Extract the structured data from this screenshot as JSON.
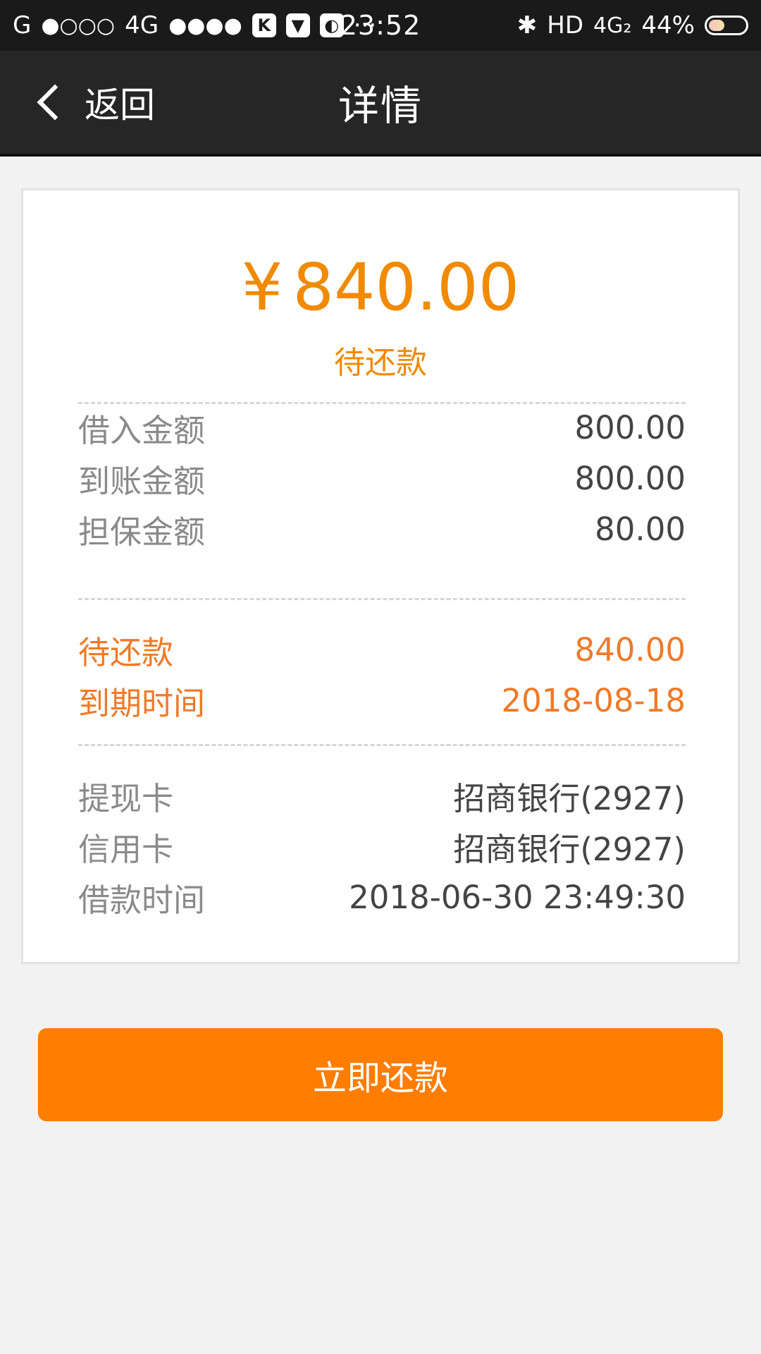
{
  "status_bar": {
    "carrier_1": "G",
    "signal_1": "●○○○",
    "network_2": "4G",
    "signal_2": "●●●●",
    "app_icon_k": "K",
    "more": "···",
    "time": "23:52",
    "bluetooth": "✱",
    "hd": "HD",
    "network_3": "4G₂",
    "battery_percent": "44%",
    "battery_level": 0.44
  },
  "nav": {
    "back_label": "返回",
    "title": "详情"
  },
  "summary": {
    "currency": "¥",
    "amount": "840.00",
    "status": "待还款"
  },
  "loan_rows": [
    {
      "label": "借入金额",
      "value": "800.00"
    },
    {
      "label": "到账金额",
      "value": "800.00"
    },
    {
      "label": "担保金额",
      "value": "80.00"
    }
  ],
  "due_rows": [
    {
      "label": "待还款",
      "value": "840.00"
    },
    {
      "label": "到期时间",
      "value": "2018-08-18"
    }
  ],
  "card_rows": [
    {
      "label": "提现卡",
      "value": "招商银行(2927)"
    },
    {
      "label": "信用卡",
      "value": "招商银行(2927)"
    },
    {
      "label": "借款时间",
      "value": "2018-06-30 23:49:30"
    }
  ],
  "actions": {
    "repay_label": "立即还款"
  },
  "colors": {
    "accent": "#ff7d00",
    "amount": "#f08a00",
    "highlight": "#ef7a28"
  }
}
